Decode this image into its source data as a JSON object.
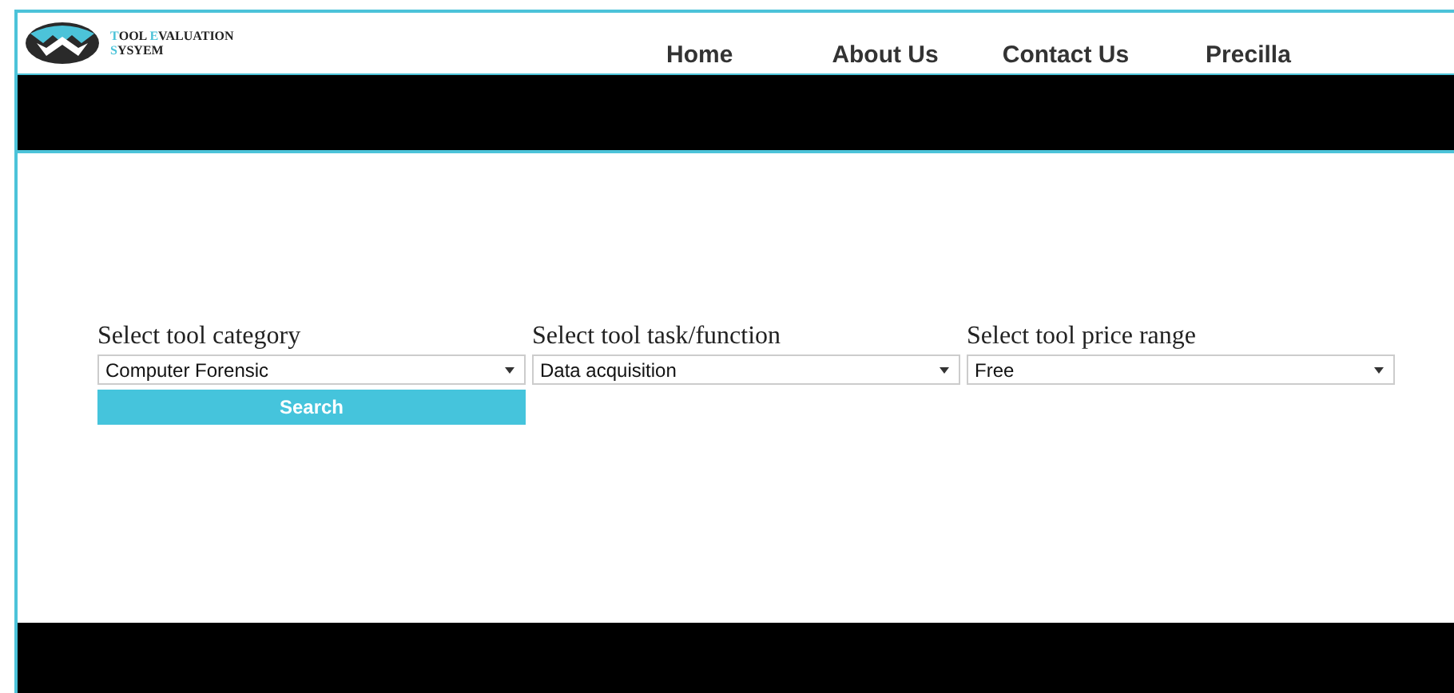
{
  "logo": {
    "lines": [
      "TOOL EVALUATION",
      "SYSYEM"
    ]
  },
  "nav": [
    {
      "label": "Home"
    },
    {
      "label": "About Us"
    },
    {
      "label": "Contact Us"
    },
    {
      "label": "Precilla"
    }
  ],
  "form": {
    "fields": [
      {
        "label": "Select tool category",
        "value": "Computer Forensic"
      },
      {
        "label": "Select tool task/function",
        "value": "Data acquisition"
      },
      {
        "label": "Select tool price range",
        "value": "Free"
      }
    ],
    "button": "Search"
  }
}
